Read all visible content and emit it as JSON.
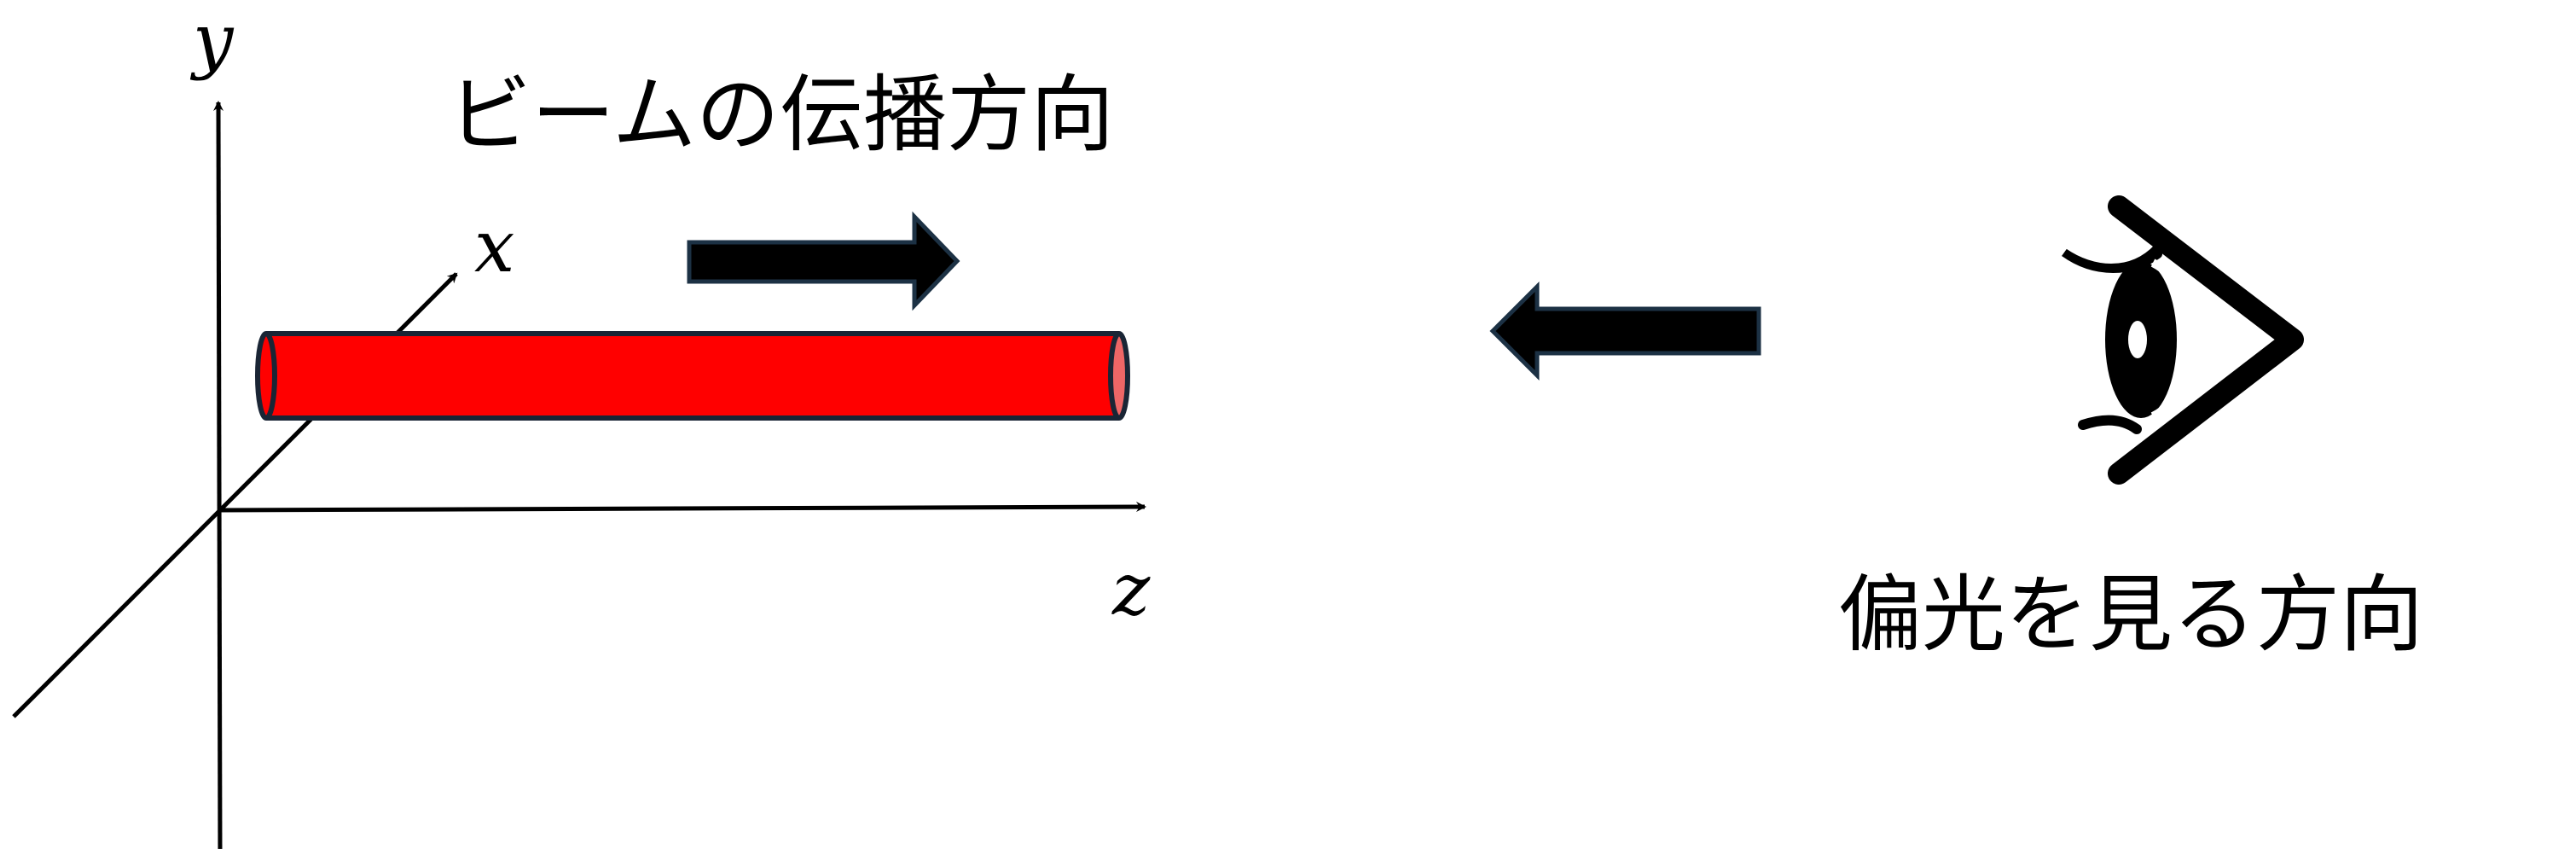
{
  "axes": {
    "x_label": "x",
    "y_label": "y",
    "z_label": "z"
  },
  "captions": {
    "propagation": "ビームの伝播方向",
    "viewing": "偏光を見る方向"
  },
  "icons": {
    "propagation_arrow": "right-arrow-icon",
    "viewing_arrow": "left-arrow-icon",
    "eye": "eye-icon"
  },
  "colors": {
    "beam_fill": "#ff0000",
    "beam_end_fill": "#ee6666",
    "beam_outline": "#1a2535",
    "arrow_fill": "#000000",
    "arrow_outline": "#1c3144",
    "axis": "#000000"
  }
}
